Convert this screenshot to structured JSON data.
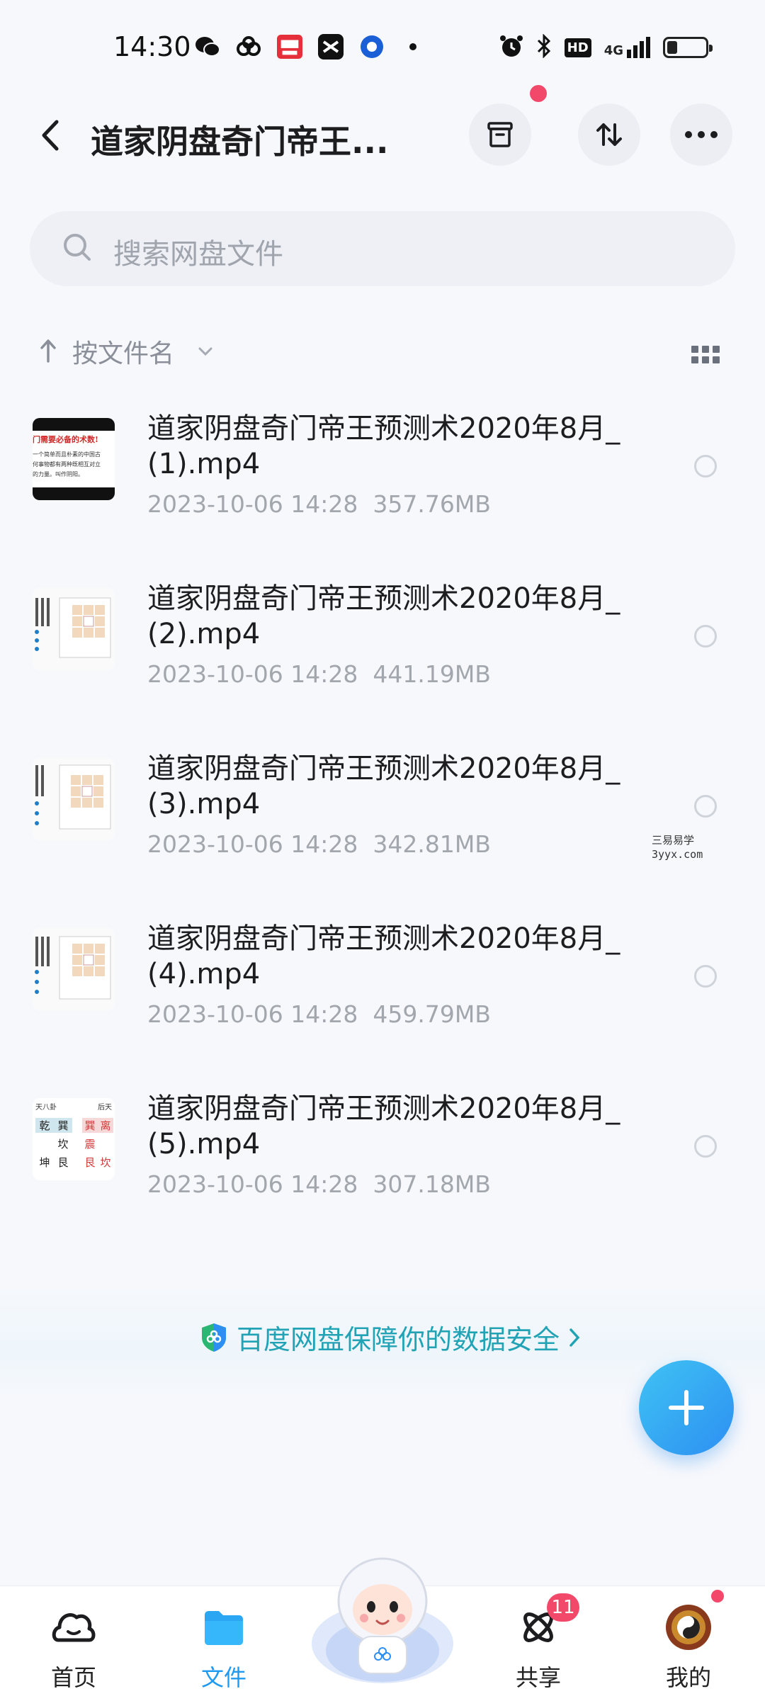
{
  "status_bar": {
    "time": "14:30",
    "network": "4G",
    "hd": "HD"
  },
  "header": {
    "title": "道家阴盘奇门帝王..."
  },
  "search": {
    "placeholder": "搜索网盘文件"
  },
  "sort": {
    "label": "按文件名"
  },
  "files": [
    {
      "name": "道家阴盘奇门帝王预测术2020年8月_(1).mp4",
      "date": "2023-10-06  14:28",
      "size": "357.76MB"
    },
    {
      "name": "道家阴盘奇门帝王预测术2020年8月_(2).mp4",
      "date": "2023-10-06  14:28",
      "size": "441.19MB"
    },
    {
      "name": "道家阴盘奇门帝王预测术2020年8月_(3).mp4",
      "date": "2023-10-06  14:28",
      "size": "342.81MB"
    },
    {
      "name": "道家阴盘奇门帝王预测术2020年8月_(4).mp4",
      "date": "2023-10-06  14:28",
      "size": "459.79MB"
    },
    {
      "name": "道家阴盘奇门帝王预测术2020年8月_(5).mp4",
      "date": "2023-10-06  14:28",
      "size": "307.18MB"
    }
  ],
  "thumb_text": {
    "t1": [
      "门需要必备的术数!",
      "一个简单而且朴素的中国古",
      "何事物都有两种既相互对立",
      "的力量。叫作阴阳。"
    ],
    "t5": [
      "天八卦",
      "后天",
      "乾",
      "巽",
      "巽",
      "离",
      "坎",
      "震",
      "坤",
      "艮",
      "艮",
      "坎"
    ]
  },
  "watermark": {
    "line1": "三易易学",
    "line2": "3yyx.com"
  },
  "security_banner": {
    "text": "百度网盘保障你的数据安全"
  },
  "tabs": [
    {
      "label": "首页",
      "icon": "home-icon"
    },
    {
      "label": "文件",
      "icon": "folder-icon"
    },
    {
      "label": "共享",
      "icon": "share-atom-icon",
      "badge": "11"
    },
    {
      "label": "我的",
      "icon": "avatar"
    }
  ],
  "colors": {
    "accent": "#1e9af0",
    "teal": "#21a3b5",
    "badge": "#f2486a"
  }
}
